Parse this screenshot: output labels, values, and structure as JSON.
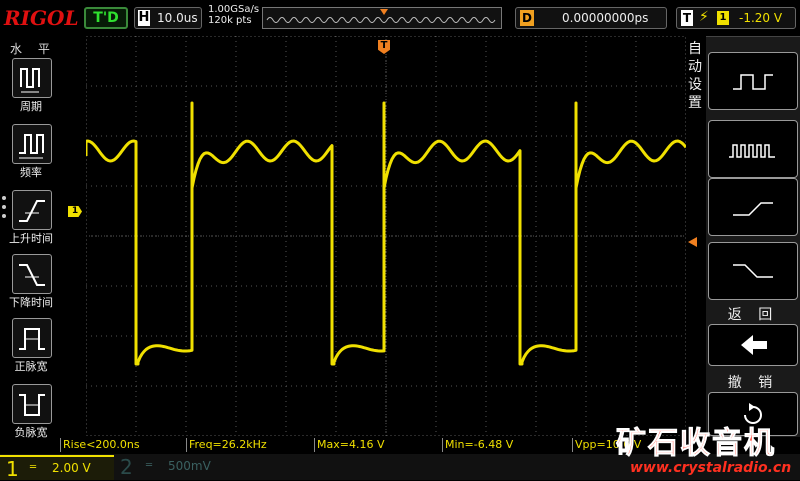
{
  "header": {
    "logo": "RIGOL",
    "run_status": "T'D",
    "horizontal": {
      "key": "H",
      "scale": "10.0us"
    },
    "sample_rate": "1.00GSa/s",
    "memory_depth": "120k pts",
    "delay": {
      "key": "D",
      "value": "0.00000000ps"
    },
    "trigger": {
      "key": "T",
      "edge_icon": "rising-edge",
      "source": "1",
      "level": "-1.20 V"
    }
  },
  "left_menu": {
    "title": "水 平",
    "items": [
      {
        "label": "周期",
        "icon": "period-icon"
      },
      {
        "label": "频率",
        "icon": "frequency-icon"
      },
      {
        "label": "上升时间",
        "icon": "rise-time-icon"
      },
      {
        "label": "下降时间",
        "icon": "fall-time-icon"
      },
      {
        "label": "正脉宽",
        "icon": "positive-width-icon"
      },
      {
        "label": "负脉宽",
        "icon": "negative-width-icon"
      }
    ]
  },
  "right_menu": {
    "title": "自动设置",
    "buttons": [
      "wide-pulse-icon",
      "narrow-pulse-icon",
      "rising-edge-icon",
      "falling-edge-icon"
    ],
    "back_label": "返 回",
    "undo_label": "撤 销"
  },
  "markers": {
    "channel1": "1",
    "trigger_pos": "T"
  },
  "measurements": [
    "Rise<200.0ns",
    "Freq=26.2kHz",
    "Max=4.16 V",
    "Min=-6.48 V",
    "Vpp=10.6 V"
  ],
  "channels": [
    {
      "number": "1",
      "coupling": "═",
      "scale": "2.00 V",
      "color": "#f0e000"
    },
    {
      "number": "2",
      "coupling": "═",
      "scale": "500mV",
      "color": "#3a6060"
    }
  ],
  "watermark": {
    "title": "矿石收音机",
    "url": "www.crystalradio.cn"
  },
  "colors": {
    "trace": "#f0e000",
    "grid": "#555555",
    "accent": "#f08020"
  }
}
